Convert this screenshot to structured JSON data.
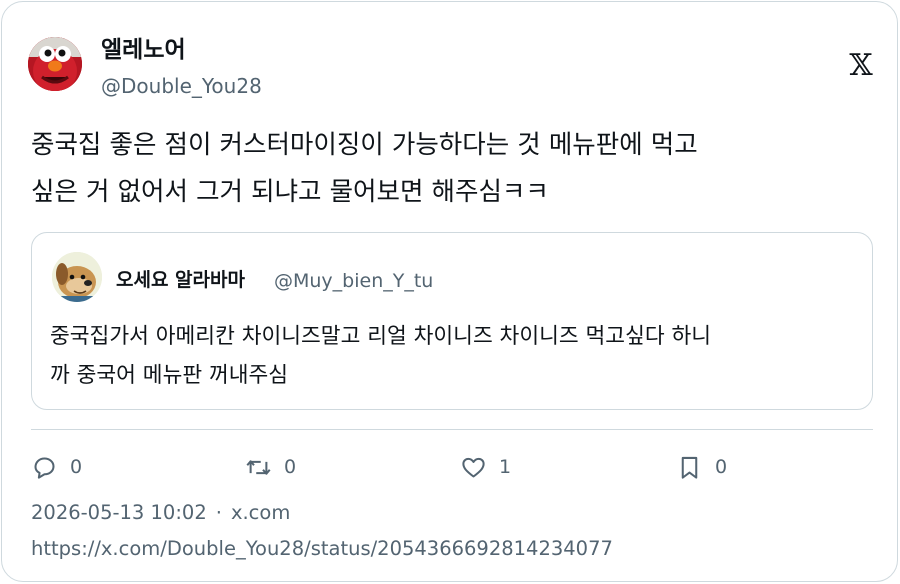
{
  "author": {
    "name": "엘레노어",
    "handle": "@Double_You28",
    "avatar_icon": "red-furry-puppet-avatar"
  },
  "brand_icon": "x-logo-icon",
  "tweet": {
    "text": "중국집 좋은 점이 커스터마이징이 가능하다는 것 메뉴판에 먹고\n싶은 거 없어서 그거 되냐고 물어보면 해주심ㅋㅋ"
  },
  "quoted": {
    "name": "오세요 알라바마",
    "handle": "@Muy_bien_Y_tu",
    "avatar_icon": "cartoon-dog-avatar",
    "text": "중국집가서 아메리칸 차이니즈말고 리얼 차이니즈 차이니즈 먹고싶다 하니\n까 중국어 메뉴판 꺼내주심"
  },
  "actions": {
    "reply": {
      "icon": "reply-icon",
      "count": "0"
    },
    "retweet": {
      "icon": "retweet-icon",
      "count": "0"
    },
    "like": {
      "icon": "heart-icon",
      "count": "1"
    },
    "bookmark": {
      "icon": "bookmark-icon",
      "count": "0"
    }
  },
  "meta": {
    "datetime": "2026-05-13 10:02",
    "separator": "·",
    "source": "x.com"
  },
  "url": "https://x.com/Double_You28/status/2054366692814234077",
  "colors": {
    "text": "#0f1419",
    "secondary": "#536471",
    "border": "#cfd9de"
  }
}
